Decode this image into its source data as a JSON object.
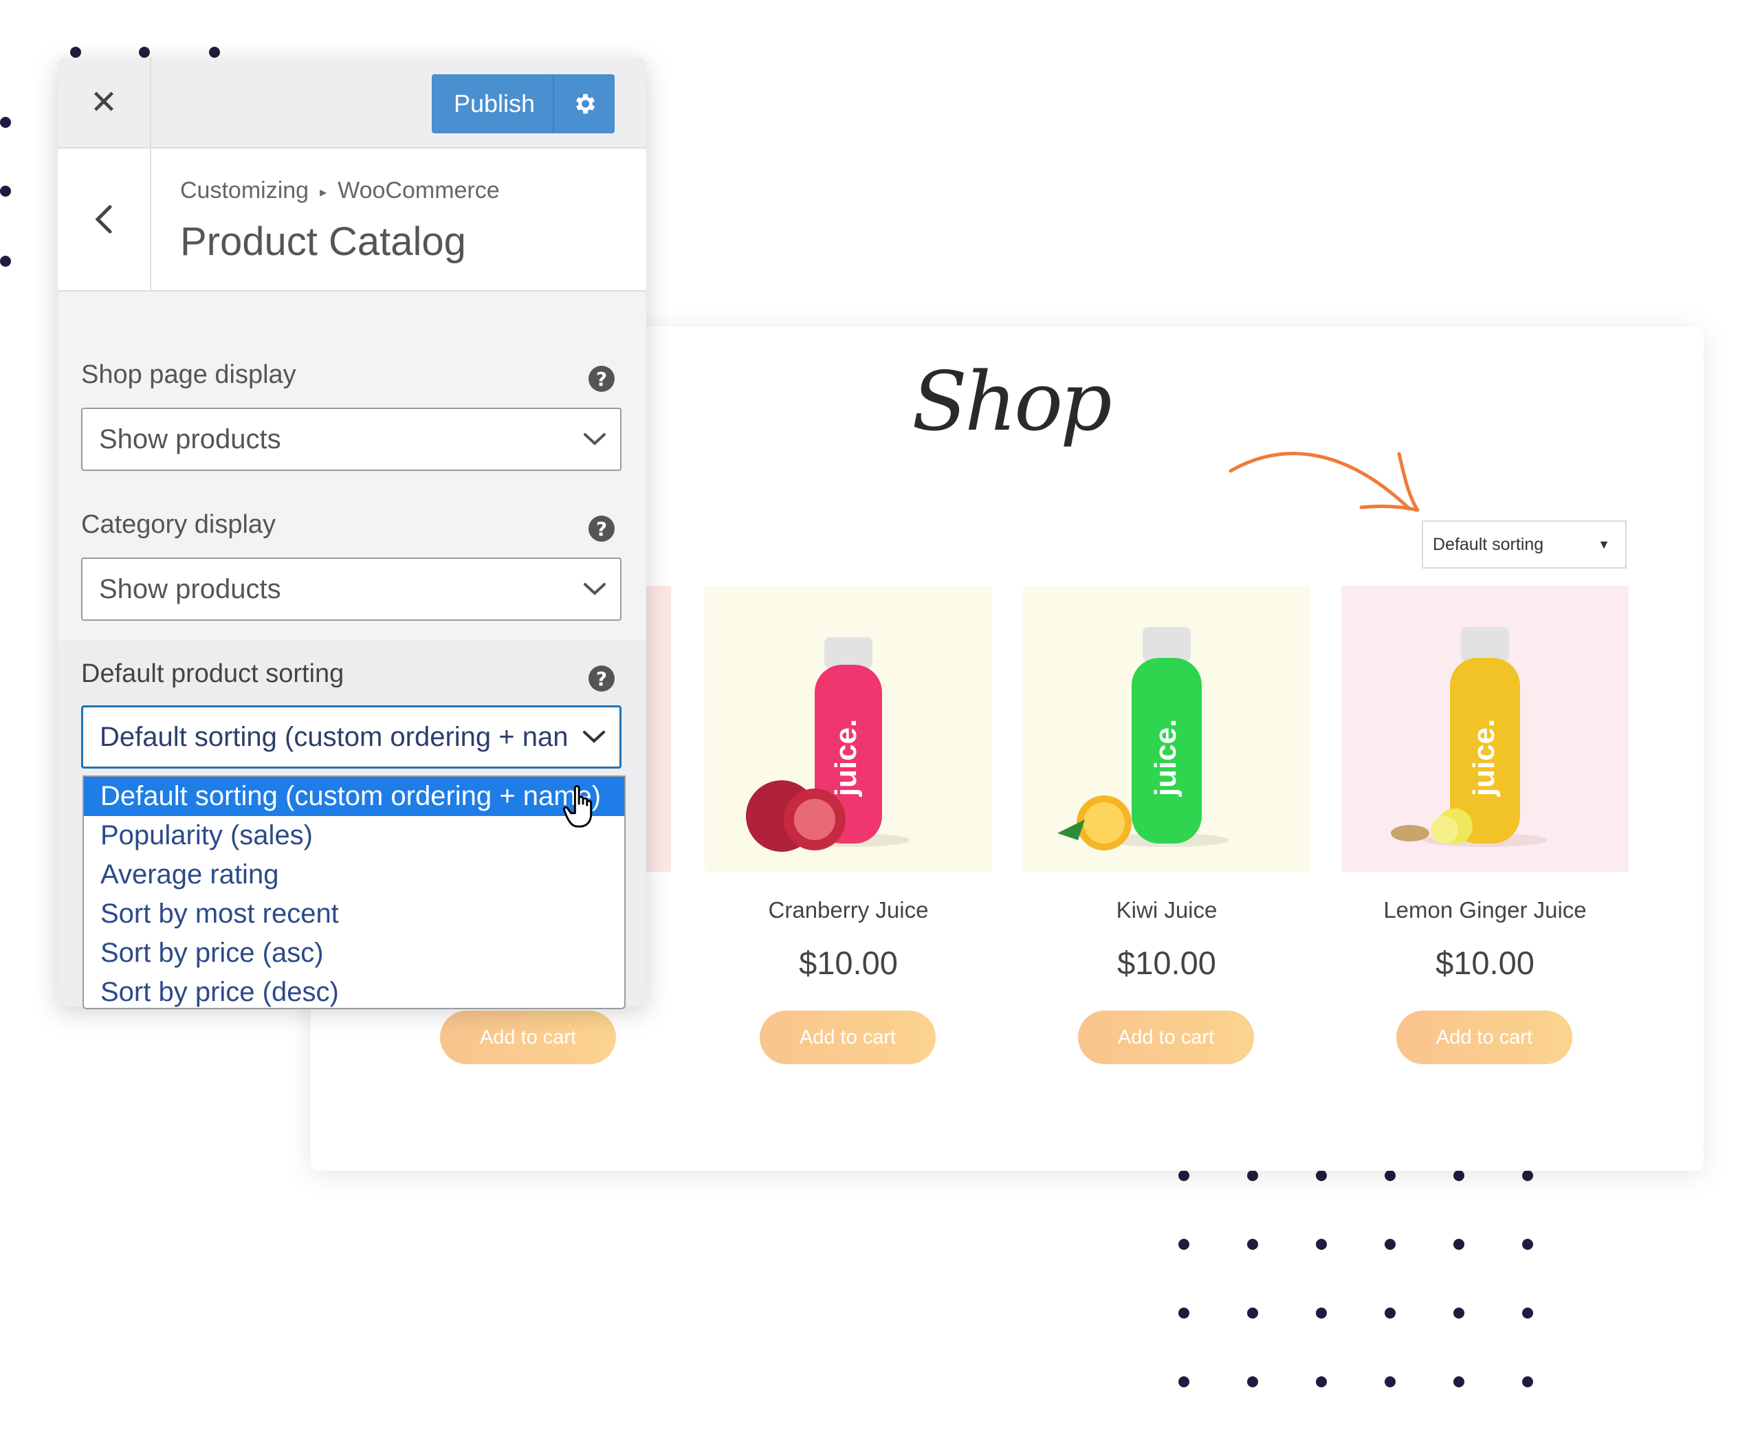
{
  "customizer": {
    "publish_label": "Publish",
    "breadcrumb": {
      "root": "Customizing",
      "child": "WooCommerce"
    },
    "section_title": "Product Catalog",
    "fields": {
      "shop_page_display": {
        "label": "Shop page display",
        "value": "Show products"
      },
      "category_display": {
        "label": "Category display",
        "value": "Show products"
      },
      "default_sorting": {
        "label": "Default product sorting",
        "value": "Default sorting (custom ordering + nan"
      }
    },
    "sorting_options": [
      "Default sorting (custom ordering + name)",
      "Popularity (sales)",
      "Average rating",
      "Sort by most recent",
      "Sort by price (asc)",
      "Sort by price (desc)"
    ],
    "selected_option_index": 0
  },
  "shop": {
    "title": "Shop",
    "sort_select": "Default sorting",
    "products": [
      {
        "name": "Cranberry Juice",
        "price": "$10.00",
        "button": "Add to cart",
        "bottle_color": "#f0366f",
        "bg": "#fcfbe9"
      },
      {
        "name": "Kiwi Juice",
        "price": "$10.00",
        "button": "Add to cart",
        "bottle_color": "#2fd44f",
        "bg": "#fcfbe9"
      },
      {
        "name": "Lemon Ginger Juice",
        "price": "$10.00",
        "button": "Add to cart",
        "bottle_color": "#f2c327",
        "bg": "#fcebef"
      }
    ],
    "partial_product_button": "Add to cart",
    "bottle_label": "juice."
  },
  "colors": {
    "publish_blue": "#4a8fcf",
    "dropdown_highlight": "#1e7de6",
    "cart_button": "#f9c48e",
    "arrow_orange": "#f07a3a"
  }
}
